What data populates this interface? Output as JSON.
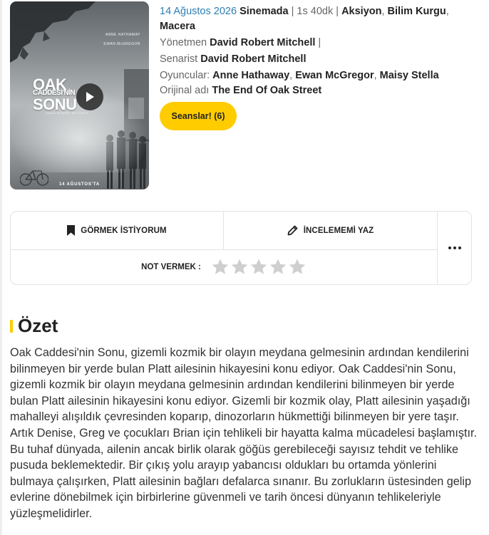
{
  "movie": {
    "release_date": "14 Ağustos 2026",
    "status": "Sinemada",
    "duration": "1s 40dk",
    "genres": [
      "Aksiyon",
      "Bilim Kurgu",
      "Macera"
    ],
    "director_label": "Yönetmen",
    "director": "David Robert Mitchell",
    "writer_label": "Senarist",
    "writer": "David Robert Mitchell",
    "cast_label": "Oyuncular:",
    "cast": [
      "Anne Hathaway",
      "Ewan McGregor",
      "Maisy Stella"
    ],
    "original_title_label": "Orijinal adı",
    "original_title": "The End Of Oak Street",
    "showtimes_button": "Seanslar! (6)"
  },
  "poster": {
    "cast_1": "ANNE HATHAWAY",
    "cast_2": "EWAN McGREGOR",
    "title_line_1": "OAK",
    "title_line_2": "CADDESİ'NİN",
    "title_line_3": "SONU",
    "director_credit": "DAVID ROBERT MITCHELL",
    "date": "14 AĞUSTOS'TA"
  },
  "actions": {
    "watchlist_label": "GÖRMEK İSTİYORUM",
    "review_label": "İNCELEMEMİ YAZ",
    "rate_label": "NOT VERMEK :",
    "star_count": 5,
    "current_rating": 0
  },
  "summary": {
    "title": "Özet",
    "text": "Oak Caddesi'nin Sonu, gizemli kozmik bir olayın meydana gelmesinin ardından kendilerini bilinmeyen bir yerde bulan Platt ailesinin hikayesini konu ediyor. Oak Caddesi'nin Sonu, gizemli kozmik bir olayın meydana gelmesinin ardından kendilerini bilinmeyen bir yerde bulan Platt ailesinin hikayesini konu ediyor. Gizemli bir kozmik olay, Platt ailesinin yaşadığı mahalleyi alışıldık çevresinden koparıp, dinozorların hükmettiği bilinmeyen bir yere taşır. Artık Denise, Greg ve çocukları Brian için tehlikeli bir hayatta kalma mücadelesi başlamıştır. Bu tuhaf dünyada, ailenin ancak birlik olarak göğüs gerebileceği sayısız tehdit ve tehlike pusuda beklemektedir. Bir çıkış yolu arayıp yabancısı oldukları bu ortamda yönlerini bulmaya çalışırken, Platt ailesinin bağları defalarca sınanır. Bu zorlukların üstesinden gelip evlerine dönebilmek için birbirlerine güvenmeli ve tarih öncesi dünyanın tehlikeleriyle yüzleşmelidirler."
  },
  "colors": {
    "accent_yellow": "#ffcc00",
    "link_blue": "#2d7fb3",
    "star_empty": "#cfcfcf"
  }
}
